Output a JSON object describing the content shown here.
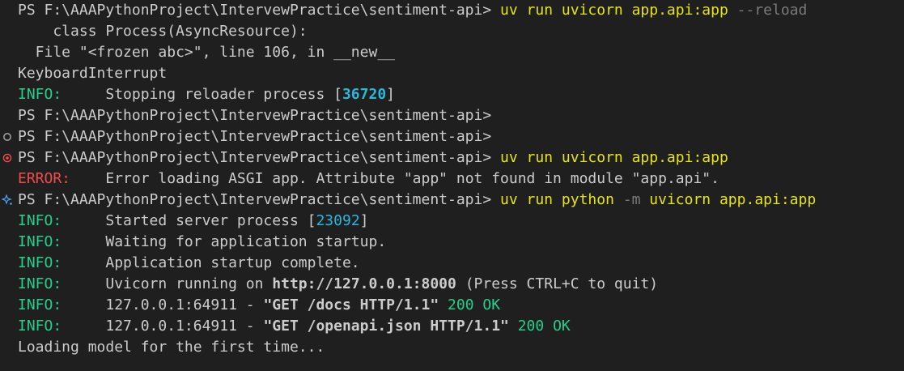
{
  "terminal": {
    "lines": [
      {
        "segments": [
          {
            "text": "PS F:\\AAAPythonProject\\IntervewPractice\\sentiment-api> ",
            "cls": ""
          },
          {
            "text": "uv run uvicorn app.api:app",
            "cls": "yellow"
          },
          {
            "text": " --reload",
            "cls": "gray"
          }
        ]
      },
      {
        "segments": [
          {
            "text": "    class Process(AsyncResource):",
            "cls": ""
          }
        ]
      },
      {
        "segments": [
          {
            "text": "  File \"<frozen abc>\", line 106, in __new__",
            "cls": ""
          }
        ]
      },
      {
        "segments": [
          {
            "text": "KeyboardInterrupt",
            "cls": ""
          }
        ]
      },
      {
        "segments": [
          {
            "text": "INFO:",
            "cls": "green"
          },
          {
            "text": "     Stopping reloader process [",
            "cls": ""
          },
          {
            "text": "36720",
            "cls": "cyan bold"
          },
          {
            "text": "]",
            "cls": ""
          }
        ]
      },
      {
        "segments": [
          {
            "text": "PS F:\\AAAPythonProject\\IntervewPractice\\sentiment-api>",
            "cls": ""
          }
        ]
      },
      {
        "decoration": "circle-outline-icon",
        "segments": [
          {
            "text": "PS F:\\AAAPythonProject\\IntervewPractice\\sentiment-api>",
            "cls": ""
          }
        ]
      },
      {
        "decoration": "error-circle-icon",
        "segments": [
          {
            "text": "PS F:\\AAAPythonProject\\IntervewPractice\\sentiment-api> ",
            "cls": ""
          },
          {
            "text": "uv run uvicorn app.api:app",
            "cls": "yellow"
          }
        ]
      },
      {
        "segments": [
          {
            "text": "ERROR:",
            "cls": "red"
          },
          {
            "text": "    Error loading ASGI app. Attribute \"app\" not found in module \"app.api\".",
            "cls": ""
          }
        ]
      },
      {
        "decoration": "sparkle-icon",
        "segments": [
          {
            "text": "PS F:\\AAAPythonProject\\IntervewPractice\\sentiment-api> ",
            "cls": ""
          },
          {
            "text": "uv run python ",
            "cls": "yellow"
          },
          {
            "text": "-m",
            "cls": "gray"
          },
          {
            "text": " uvicorn app.api:app",
            "cls": "yellow"
          }
        ]
      },
      {
        "segments": [
          {
            "text": "INFO:",
            "cls": "green"
          },
          {
            "text": "     Started server process [",
            "cls": ""
          },
          {
            "text": "23092",
            "cls": "cyan"
          },
          {
            "text": "]",
            "cls": ""
          }
        ]
      },
      {
        "segments": [
          {
            "text": "INFO:",
            "cls": "green"
          },
          {
            "text": "     Waiting for application startup.",
            "cls": ""
          }
        ]
      },
      {
        "segments": [
          {
            "text": "INFO:",
            "cls": "green"
          },
          {
            "text": "     Application startup complete.",
            "cls": ""
          }
        ]
      },
      {
        "segments": [
          {
            "text": "INFO:",
            "cls": "green"
          },
          {
            "text": "     Uvicorn running on ",
            "cls": ""
          },
          {
            "text": "http://127.0.0.1:8000",
            "cls": "bold"
          },
          {
            "text": " (Press CTRL+C to quit)",
            "cls": ""
          }
        ]
      },
      {
        "segments": [
          {
            "text": "INFO:",
            "cls": "green"
          },
          {
            "text": "     127.0.0.1:64911 - ",
            "cls": ""
          },
          {
            "text": "\"GET /docs HTTP/1.1\"",
            "cls": "bold"
          },
          {
            "text": " ",
            "cls": ""
          },
          {
            "text": "200 OK",
            "cls": "green"
          }
        ]
      },
      {
        "segments": [
          {
            "text": "INFO:",
            "cls": "green"
          },
          {
            "text": "     127.0.0.1:64911 - ",
            "cls": ""
          },
          {
            "text": "\"GET /openapi.json HTTP/1.1\"",
            "cls": "bold"
          },
          {
            "text": " ",
            "cls": ""
          },
          {
            "text": "200 OK",
            "cls": "green"
          }
        ]
      },
      {
        "segments": [
          {
            "text": "Loading model for the first time...",
            "cls": ""
          }
        ]
      }
    ]
  }
}
